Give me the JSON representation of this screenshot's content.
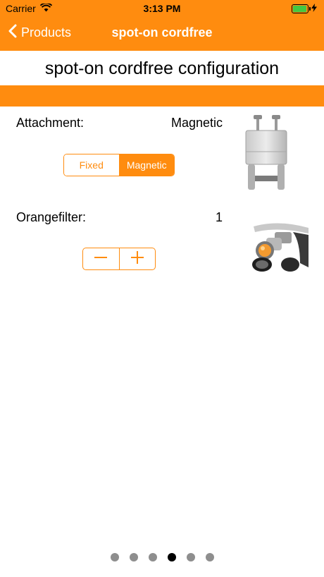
{
  "status_bar": {
    "carrier": "Carrier",
    "time": "3:13 PM",
    "icons": [
      "wifi-icon",
      "battery-icon",
      "charging-icon"
    ],
    "battery_color": "#43c743"
  },
  "nav": {
    "back_label": "Products",
    "title": "spot-on cordfree",
    "back_icon": "chevron-left-icon"
  },
  "page_title": "spot-on cordfree configuration",
  "options": {
    "attachment": {
      "label": "Attachment:",
      "value": "Magnetic",
      "segments": [
        "Fixed",
        "Magnetic"
      ],
      "selected": "Magnetic",
      "image_icon": "magnetic-clip-image"
    },
    "orangefilter": {
      "label": "Orangefilter:",
      "value": "1",
      "stepper_icons": [
        "minus-icon",
        "plus-icon"
      ],
      "image_icon": "orange-filter-headlight-image"
    }
  },
  "pager": {
    "count": 6,
    "current_index": 3
  },
  "colors": {
    "accent": "#ff8c0f",
    "text": "#000000",
    "dot_inactive": "#8e8e8e",
    "dot_active": "#000000"
  }
}
